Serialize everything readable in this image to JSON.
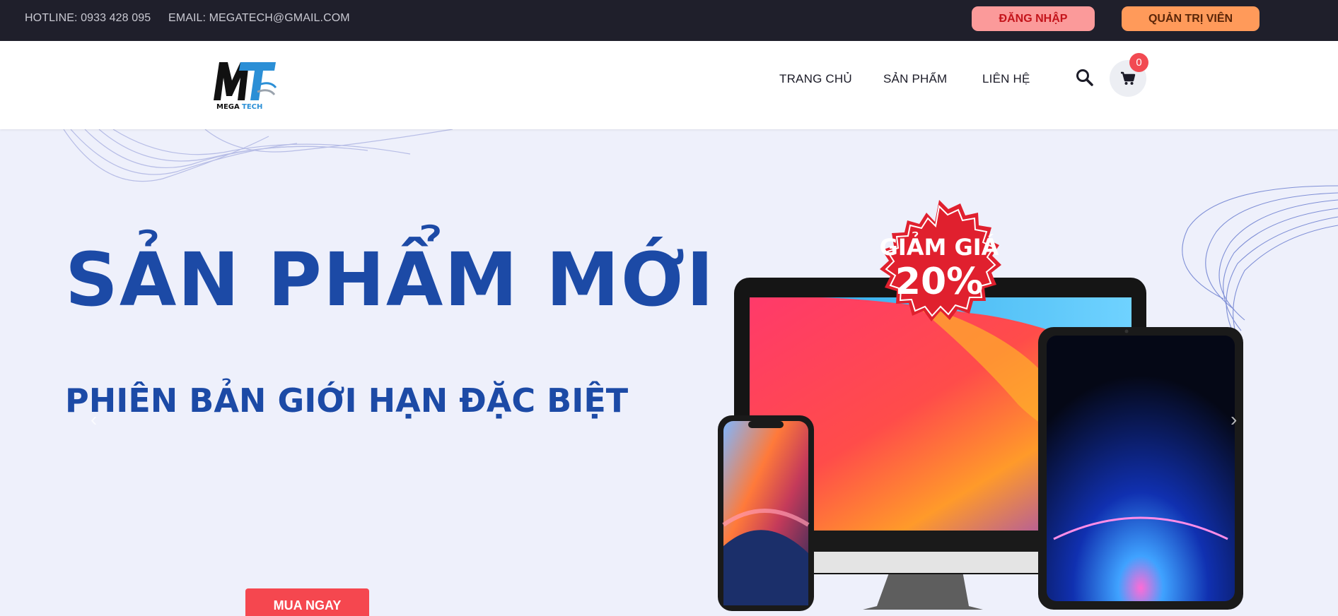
{
  "topbar": {
    "hotline": "HOTLINE: 0933 428 095",
    "email": "EMAIL: MEGATECH@GMAIL.COM",
    "login_label": "ĐĂNG NHẬP",
    "admin_label": "QUẢN TRỊ VIÊN"
  },
  "header": {
    "logo_text": "MEGA TECH",
    "nav": {
      "home": "TRANG CHỦ",
      "products": "SẢN PHẨM",
      "contact": "LIÊN HỆ"
    },
    "cart_count": "0",
    "icons": [
      "search-icon",
      "cart-icon"
    ]
  },
  "hero": {
    "title": "SẢN PHẨM MỚI",
    "subtitle": "PHIÊN BẢN GIỚI HẠN ĐẶC BIỆT",
    "badge_line1": "GIẢM GIÁ",
    "badge_line2": "20%",
    "cta_label": "MUA NGAY"
  },
  "colors": {
    "topbar_bg": "#1f1f2b",
    "hero_bg": "#eef0fb",
    "title_blue": "#1c4aa6",
    "cta_red": "#f5474f",
    "badge_red": "#e0202e",
    "login_bg": "#fb9a9a",
    "admin_bg": "#ff9a5a"
  }
}
